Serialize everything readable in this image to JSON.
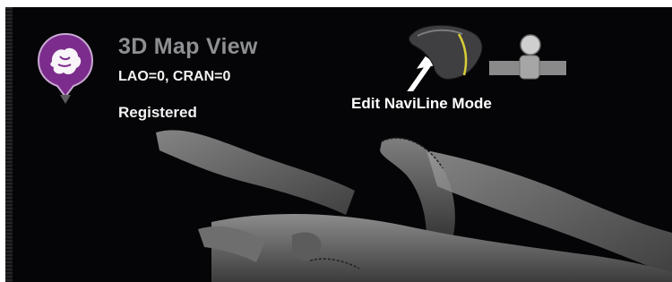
{
  "view": {
    "title": "3D Map View",
    "angles": "LAO=0, CRAN=0",
    "status": "Registered"
  },
  "toolbar": {
    "mode_label": "Edit NaviLine Mode",
    "mode_icon": "vessel-edit-icon",
    "slider_icon": "sphere-slider-icon",
    "cursor_icon": "arrow-cursor-icon"
  },
  "badge": {
    "icon": "anatomy-map-icon",
    "color": "#7b2c8c"
  },
  "colors": {
    "background": "#050507",
    "title": "#8d8f92",
    "text": "#f2f2f2"
  }
}
